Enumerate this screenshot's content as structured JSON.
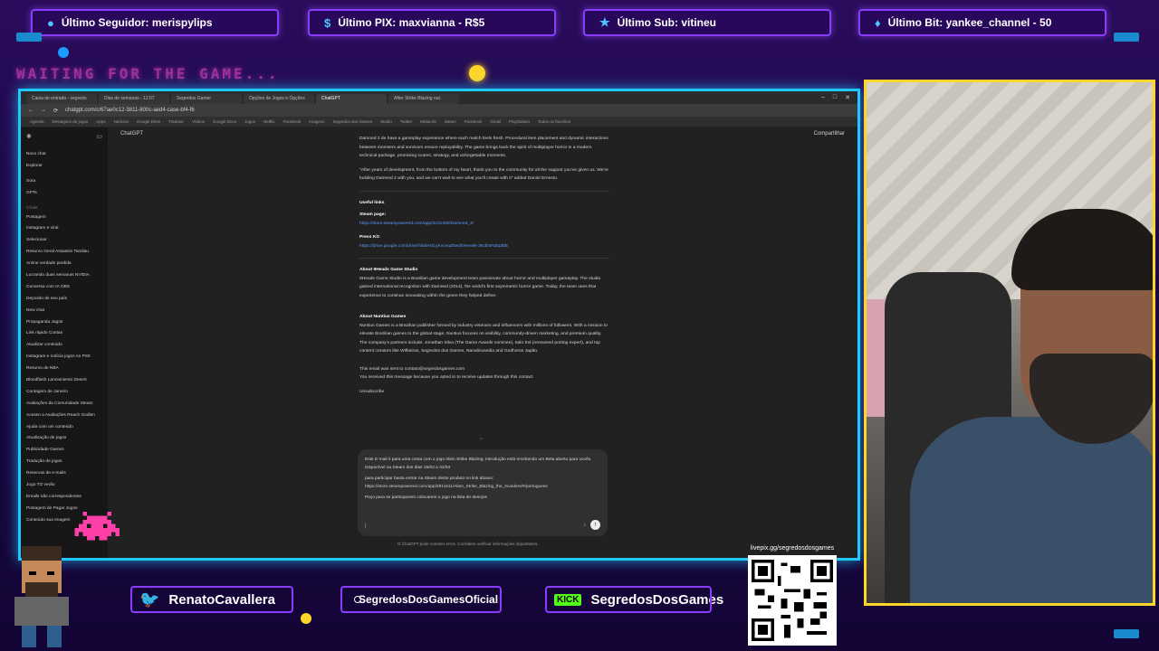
{
  "stream": {
    "top_bar": [
      {
        "icon": "user-icon",
        "label": "Último Seguidor: merispylips"
      },
      {
        "icon": "dollar-icon",
        "label": "Último PIX: maxvianna - R$5"
      },
      {
        "icon": "star-icon",
        "label": "Último Sub: vitineu"
      },
      {
        "icon": "diamond-icon",
        "label": "Último Bit: yankee_channel - 50"
      }
    ],
    "waiting_text": "WAITING FOR THE GAME...",
    "socials": [
      {
        "icon": "twitter-icon",
        "label": "RenatoCavallera"
      },
      {
        "icon": "instagram-icon",
        "label": "SegredosDosGamesOficial"
      },
      {
        "icon": "kick-icon",
        "badge": "KICK",
        "label": "SegredosDosGames"
      }
    ],
    "qr_url": "livepix.gg/segredosdosgames",
    "colors": {
      "accent": "#1ec9ff",
      "frame": "#8a3cff",
      "webcam_border": "#ffd52a",
      "waiting": "#ff4fd8"
    }
  },
  "browser": {
    "tabs": [
      "Caixa de entrada - segredo",
      "Dias de semanas - 12:07",
      "Segredos Gamer",
      "Opções de Jogos e Opções",
      "ChatGPT",
      "After Strike Blazing out."
    ],
    "url": "chatgpt.com/c/67ae0c12-3811-800c-aed4-case-bf4-f6",
    "bookmarks": [
      "Agenda",
      "Destaques de jogos",
      "Apps",
      "Notícias",
      "Google Drive",
      "Tradutor",
      "Vídeos",
      "Google Docs",
      "Jogos",
      "Netflix",
      "Facebook",
      "Imagens",
      "Segredos dos Games",
      "Studio",
      "Twitter",
      "Mídia Kit",
      "Steam",
      "Facebook",
      "Gmail",
      "PlayStation",
      "Todos os favoritos"
    ],
    "window_controls": [
      "–",
      "□",
      "✕"
    ]
  },
  "chat": {
    "app_title": "ChatGPT",
    "share_label": "Compartilhar",
    "sidebar_top": [
      "Novo chat",
      "Explorar"
    ],
    "sidebar_secondary": [
      "Sora",
      "GPTs"
    ],
    "sidebar_group": "Chats",
    "sidebar_items": [
      "Postagem",
      "Instagram e viral",
      "Selecionar",
      "Resumo Geral Assassin Tamilau",
      "Anime verdade perdida",
      "Lucrando duas semanas NVIDIA",
      "Conversa com IA OBS",
      "Deposito de seu país",
      "New chat",
      "Propaganda Jogos",
      "Link rápido Contas",
      "Atualizar conteúdo",
      "Instagram e notícia jogos no PS5",
      "Resumo de NBA",
      "Bloodflash Lanzamiento Desert",
      "Contagem de Janeiro",
      "Avaliações da Comunidade Steam",
      "Acesso a Avaliações Reach Godlen",
      "Ajuda com um conteúdo",
      "Atualização de jogos",
      "Publicidade Games",
      "Tradução de jogos",
      "Reservas de e-mails",
      "Jogo TO verão",
      "Emails não correspondentes",
      "Postagem de Pagar Jogos",
      "Conteúdo sua Imagem"
    ],
    "content": {
      "intro": "Damned 2 de have a gameplay experience where each match feels fresh. Procedural item placement and dynamic interactions between monsters and survivors ensure replayability. The game brings back the spirit of multiplayer horror in a modern technical package, promising scares, strategy, and unforgettable moments.",
      "quote": "\"After years of development, from the bottom of my heart, thank you to the community for all the support you've given us. We're building Damned 2 with you, and we can't wait to see what you'll create with it\" added Daniel Ernesto.",
      "useful_links_title": "Useful links",
      "steam_label": "Steam page:",
      "steam_link": "https://store.steampowered.com/app/2231380/Damned_2/",
      "presskit_label": "Press Kit:",
      "presskit_link": "https://drive.google.com/drive/folders/1yKvceuZ9w4bHew9k-3KdbsRdtq3bE",
      "about_studio_title": "About 9Heads Game Studio",
      "about_studio": "9Heads Game Studio is a Brazilian game development team passionate about horror and multiplayer gameplay. The studio gained international recognition with Damned (2014), the world's first asymmetric horror game. Today, the team uses that experience to continue innovating within the genre they helped define.",
      "about_nuntius_title": "About Nuntius Games",
      "about_nuntius": "Nuntius Games is a Brazilian publisher formed by industry veterans and influencers with millions of followers. With a mission to elevate Brazilian games to the global stage, Nuntius focuses on visibility, community-driven marketing, and premium quality. The company's partners include: Jonathan Silva (The Game Awards nominee), Italo Sol (renowned porting expert), and top content creators like Wilheiras, Segredos dos Games, Nanalinvandia and Godhorse Japão.",
      "email_note": "This email was sent to contato@segredosgames.com",
      "received_note": "You received this message because you opted in to receive updates through this contact.",
      "unsubscribe": "Unsubscribe"
    },
    "composer": {
      "line1": "Este E-mail é para uma conta com o jogo Alien Strike Blazing; Introdução está recebendo um Beta aberto para vocês. Disponível na Steam dos dias 15/03 a 31/03",
      "line2": "para participar basta entrar na Steam deste produto no link abaixo:",
      "link": "https://store.steampowered.com/app/2811511/Alien_Strike_Blazing_the_Invaders/#/portuguese",
      "line3": "Peço para se participarem colocarem o jogo na lista de desejos",
      "disclaimer": "O ChatGPT pode cometer erros. Considere verificar informações importantes.",
      "send_icon": "↑"
    }
  }
}
